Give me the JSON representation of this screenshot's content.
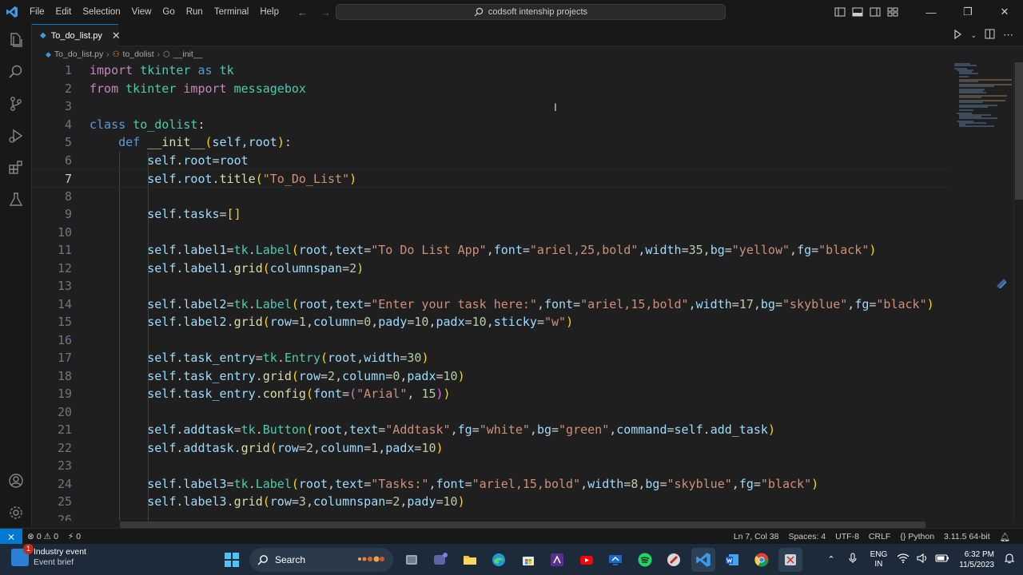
{
  "titlebar": {
    "menu": [
      "File",
      "Edit",
      "Selection",
      "View",
      "Go",
      "Run",
      "Terminal",
      "Help"
    ],
    "search_text": "codsoft intenship projects",
    "minimize": "—",
    "maximize": "❐",
    "close": "✕"
  },
  "tab": {
    "filename": "To_do_list.py"
  },
  "breadcrumb": [
    "To_do_list.py",
    "to_dolist",
    "__init__"
  ],
  "editor": {
    "current_line": 7,
    "lines": [
      {
        "n": "1",
        "t": "import tkinter as tk"
      },
      {
        "n": "2",
        "t": "from tkinter import messagebox"
      },
      {
        "n": "3",
        "t": ""
      },
      {
        "n": "4",
        "t": "class to_dolist:"
      },
      {
        "n": "5",
        "t": "    def __init__(self,root):"
      },
      {
        "n": "6",
        "t": "        self.root=root"
      },
      {
        "n": "7",
        "t": "        self.root.title(\"To_Do_List\")"
      },
      {
        "n": "8",
        "t": ""
      },
      {
        "n": "9",
        "t": "        self.tasks=[]"
      },
      {
        "n": "10",
        "t": ""
      },
      {
        "n": "11",
        "t": "        self.label1=tk.Label(root,text=\"To Do List App\",font=\"ariel,25,bold\",width=35,bg=\"yellow\",fg=\"black\")"
      },
      {
        "n": "12",
        "t": "        self.label1.grid(columnspan=2)"
      },
      {
        "n": "13",
        "t": ""
      },
      {
        "n": "14",
        "t": "        self.label2=tk.Label(root,text=\"Enter your task here:\",font=\"ariel,15,bold\",width=17,bg=\"skyblue\",fg=\"black\")"
      },
      {
        "n": "15",
        "t": "        self.label2.grid(row=1,column=0,pady=10,padx=10,sticky=\"w\")"
      },
      {
        "n": "16",
        "t": ""
      },
      {
        "n": "17",
        "t": "        self.task_entry=tk.Entry(root,width=30)"
      },
      {
        "n": "18",
        "t": "        self.task_entry.grid(row=2,column=0,padx=10)"
      },
      {
        "n": "19",
        "t": "        self.task_entry.config(font=(\"Arial\", 15))"
      },
      {
        "n": "20",
        "t": ""
      },
      {
        "n": "21",
        "t": "        self.addtask=tk.Button(root,text=\"Addtask\",fg=\"white\",bg=\"green\",command=self.add_task)"
      },
      {
        "n": "22",
        "t": "        self.addtask.grid(row=2,column=1,padx=10)"
      },
      {
        "n": "23",
        "t": ""
      },
      {
        "n": "24",
        "t": "        self.label3=tk.Label(root,text=\"Tasks:\",font=\"ariel,15,bold\",width=8,bg=\"skyblue\",fg=\"black\")"
      },
      {
        "n": "25",
        "t": "        self.label3.grid(row=3,columnspan=2,pady=10)"
      },
      {
        "n": "26",
        "t": ""
      }
    ]
  },
  "statusbar": {
    "errors": "0",
    "warnings": "0",
    "ports": "0",
    "position": "Ln 7, Col 38",
    "spaces": "Spaces: 4",
    "encoding": "UTF-8",
    "eol": "CRLF",
    "language": "Python",
    "interpreter": "3.11.5 64-bit"
  },
  "taskbar": {
    "notification_count": "1",
    "widget_title": "Industry event",
    "widget_sub": "Event brief",
    "search_label": "Search",
    "lang_top": "ENG",
    "lang_bottom": "IN",
    "time": "6:32 PM",
    "date": "11/5/2023"
  },
  "colors": {
    "accent": "#0078d4",
    "editor_bg": "#1f1f1f",
    "keyword": "#569cd6",
    "string": "#ce9178",
    "number": "#b5cea8",
    "function": "#dcdcaa",
    "class": "#4ec9b0",
    "variable": "#9cdcfe"
  }
}
